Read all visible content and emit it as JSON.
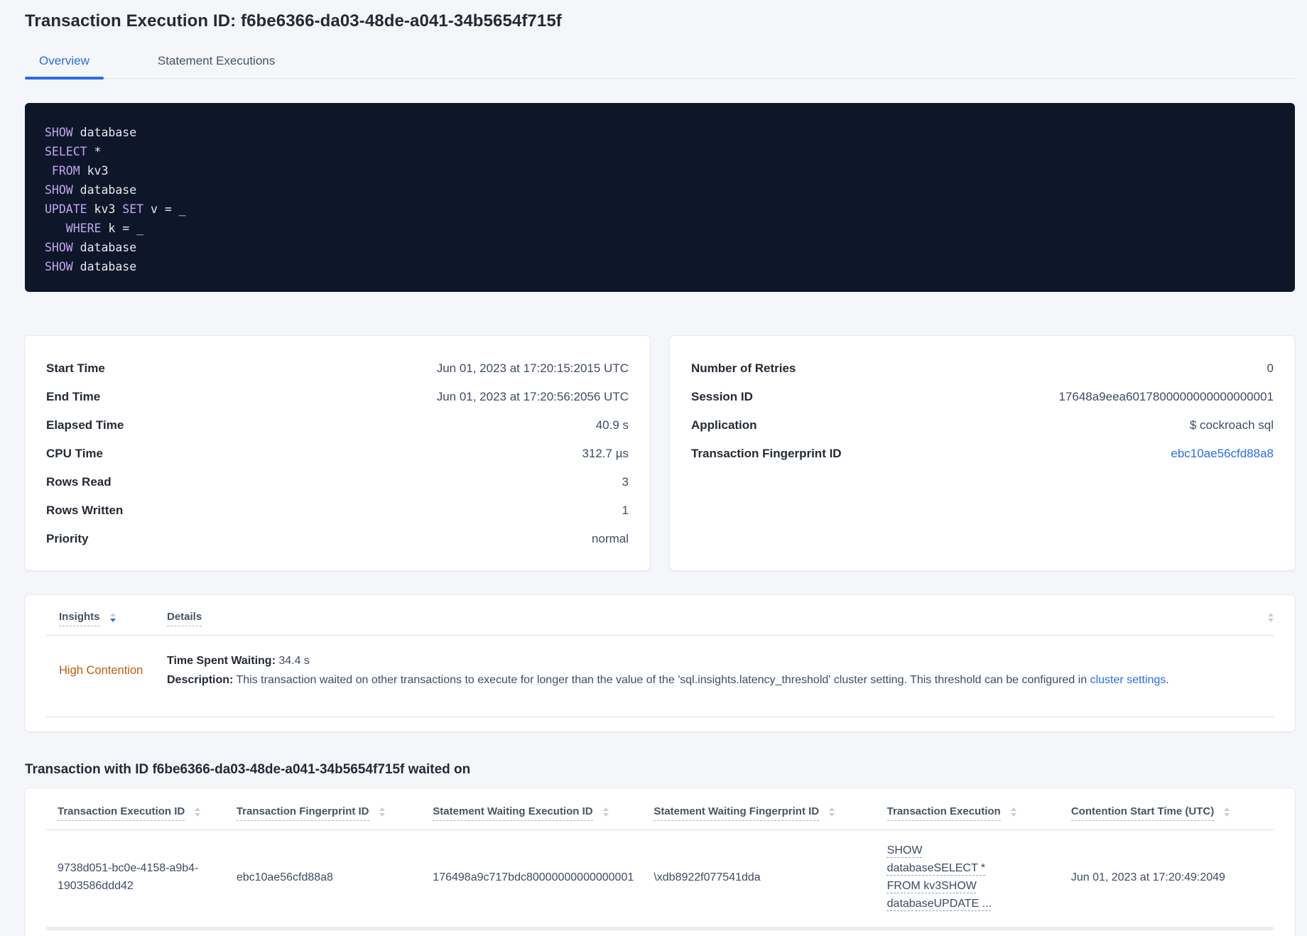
{
  "page": {
    "title": "Transaction Execution ID: f6be6366-da03-48de-a041-34b5654f715f"
  },
  "tabs": [
    {
      "label": "Overview",
      "active": true
    },
    {
      "label": "Statement Executions",
      "active": false
    }
  ],
  "sql": {
    "lines": [
      [
        {
          "text": "SHOW",
          "kw": true
        },
        {
          "text": " database",
          "kw": false
        }
      ],
      [
        {
          "text": "SELECT",
          "kw": true
        },
        {
          "text": " *",
          "kw": false
        }
      ],
      [
        {
          "text": " FROM",
          "kw": true
        },
        {
          "text": " kv3",
          "kw": false
        }
      ],
      [
        {
          "text": "SHOW",
          "kw": true
        },
        {
          "text": " database",
          "kw": false
        }
      ],
      [
        {
          "text": "UPDATE",
          "kw": true
        },
        {
          "text": " kv3 ",
          "kw": false
        },
        {
          "text": "SET",
          "kw": true
        },
        {
          "text": " v = _",
          "kw": false
        }
      ],
      [
        {
          "text": "   WHERE",
          "kw": true
        },
        {
          "text": " k = _",
          "kw": false
        }
      ],
      [
        {
          "text": "SHOW",
          "kw": true
        },
        {
          "text": " database",
          "kw": false
        }
      ],
      [
        {
          "text": "SHOW",
          "kw": true
        },
        {
          "text": " database",
          "kw": false
        }
      ]
    ]
  },
  "summary_left": {
    "rows": [
      {
        "label": "Start Time",
        "value": "Jun 01, 2023 at 17:20:15:2015 UTC"
      },
      {
        "label": "End Time",
        "value": "Jun 01, 2023 at 17:20:56:2056 UTC"
      },
      {
        "label": "Elapsed Time",
        "value": "40.9 s"
      },
      {
        "label": "CPU Time",
        "value": "312.7 µs"
      },
      {
        "label": "Rows Read",
        "value": "3"
      },
      {
        "label": "Rows Written",
        "value": "1"
      },
      {
        "label": "Priority",
        "value": "normal"
      }
    ]
  },
  "summary_right": {
    "rows": [
      {
        "label": "Number of Retries",
        "value": "0"
      },
      {
        "label": "Session ID",
        "value": "17648a9eea6017800000000000000001"
      },
      {
        "label": "Application",
        "value": "$ cockroach sql"
      },
      {
        "label": "Transaction Fingerprint ID",
        "value": "ebc10ae56cfd88a8"
      }
    ]
  },
  "insights_table": {
    "insights_header": "Insights",
    "details_header": "Details",
    "row": {
      "insight": "High Contention",
      "waiting_label": "Time Spent Waiting:",
      "waiting_value": "34.4 s",
      "description_label": "Description:",
      "description_text": "This transaction waited on other transactions to execute for longer than the value of the 'sql.insights.latency_threshold' cluster setting. This threshold can be configured in",
      "link_text": "cluster settings",
      "suffix": "."
    }
  },
  "waited_section": {
    "heading": "Transaction with ID f6be6366-da03-48de-a041-34b5654f715f waited on",
    "columns": [
      "Transaction Execution ID",
      "Transaction Fingerprint ID",
      "Statement Waiting Execution ID",
      "Statement Waiting Fingerprint ID",
      "Transaction Execution",
      "Contention Start Time (UTC)"
    ],
    "row": {
      "transaction_execution_id": "9738d051-bc0e-4158-a9b4-1903586ddd42",
      "transaction_fingerprint_id": "ebc10ae56cfd88a8",
      "statement_waiting_execution_id": "176498a9c717bdc80000000000000001",
      "statement_waiting_fingerprint_id": "\\xdb8922f077541dda",
      "transaction_execution": "SHOW databaseSELECT * FROM kv3SHOW databaseUPDATE ...",
      "contention_start_time": "Jun 01, 2023 at 17:20:49:2049"
    }
  },
  "colors": {
    "page_bg": "#f4f6fa",
    "accent_blue": "#2a6ce2",
    "insight_orange": "#bf5b0f",
    "code_bg": "#0e1729",
    "code_keyword": "#c3a5f1",
    "code_text": "#e6e8f0",
    "heading_text": "#242a35",
    "body_text": "#3f4c66"
  }
}
